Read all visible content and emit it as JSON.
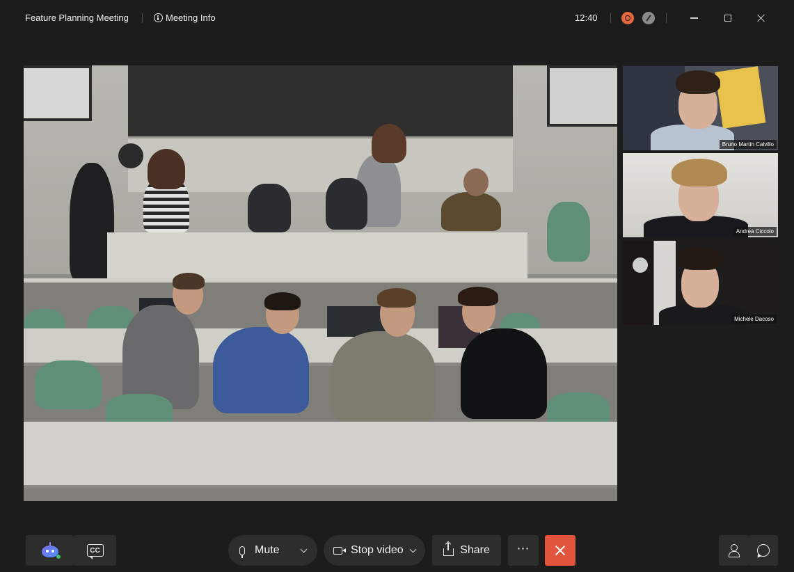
{
  "window": {
    "meeting_title": "Feature Planning Meeting",
    "meeting_info_label": "Meeting Info",
    "clock": "12:40",
    "icons": {
      "info": "info-circle-icon",
      "recording": "recording-indicator-icon",
      "tool": "tool-indicator-icon",
      "minimize": "minimize-icon",
      "maximize": "maximize-icon",
      "close": "close-icon"
    }
  },
  "participants": [
    {
      "name": "Bruno Martín Calvillo",
      "active_speaker": true
    },
    {
      "name": "Andrea Ciccolo",
      "active_speaker": false
    },
    {
      "name": "Michele Dacoso",
      "active_speaker": false
    }
  ],
  "toolbar": {
    "mute_label": "Mute",
    "stop_video_label": "Stop video",
    "share_label": "Share",
    "more_label": "⋯",
    "colors": {
      "end_call": "#e0553b",
      "button_bg": "#2d2d2d"
    },
    "icons": [
      "ai-assistant-icon",
      "closed-captions-icon",
      "microphone-icon",
      "chevron-down-icon",
      "camera-icon",
      "share-icon",
      "more-icon",
      "end-call-icon",
      "participants-icon",
      "chat-icon"
    ]
  },
  "cc_label": "CC"
}
